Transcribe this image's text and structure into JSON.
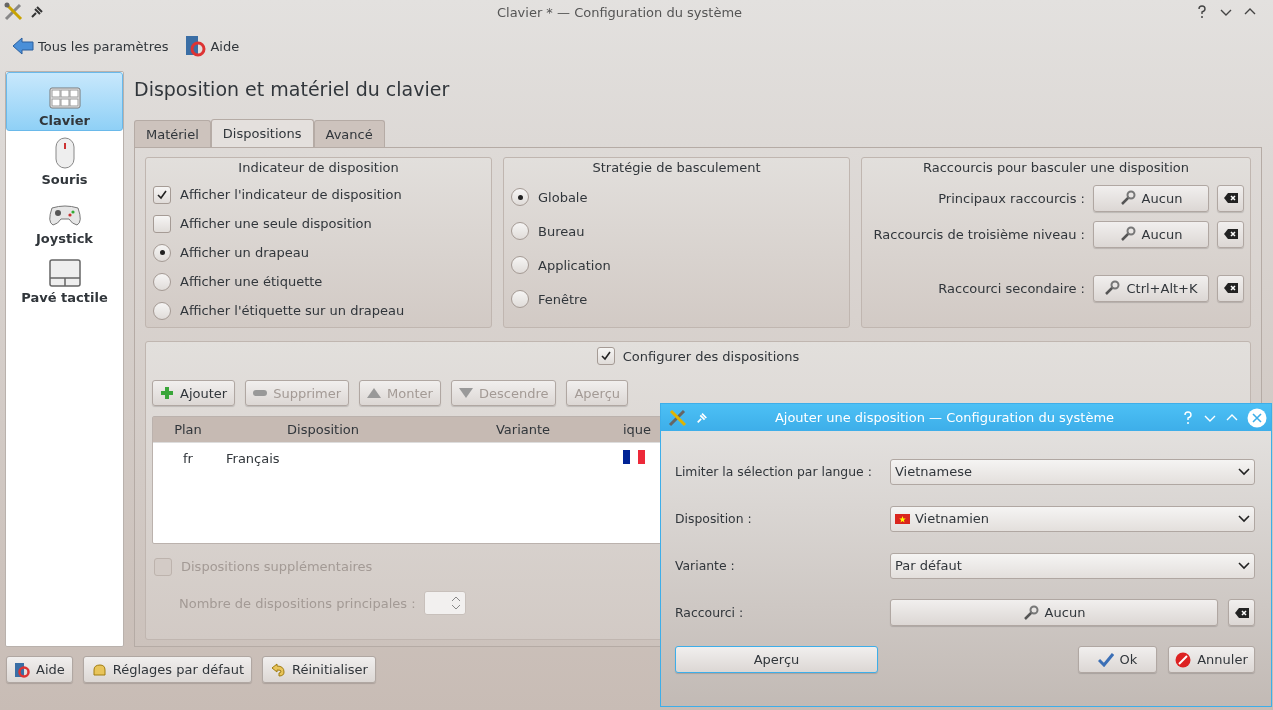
{
  "window": {
    "title": "Clavier * — Configuration du système"
  },
  "toolbar": [
    {
      "label": "Tous les paramètres",
      "kind": "back"
    },
    {
      "label": "Aide",
      "kind": "help"
    }
  ],
  "sidebar": {
    "items": [
      {
        "label": "Clavier",
        "kind": "keyboard",
        "selected": true
      },
      {
        "label": "Souris",
        "kind": "mouse",
        "selected": false
      },
      {
        "label": "Joystick",
        "kind": "gamepad",
        "selected": false
      },
      {
        "label": "Pavé tactile",
        "kind": "touchpad",
        "selected": false
      }
    ]
  },
  "page_title": "Disposition et matériel du clavier",
  "tabs": [
    {
      "label": "Matériel",
      "selected": false
    },
    {
      "label": "Dispositions",
      "selected": true
    },
    {
      "label": "Avancé",
      "selected": false
    }
  ],
  "indicator_group": {
    "title": "Indicateur de disposition",
    "options": [
      {
        "label": "Afficher l'indicateur de disposition",
        "kind": "checkbox",
        "checked": true
      },
      {
        "label": "Afficher une seule disposition",
        "kind": "checkbox",
        "checked": false
      },
      {
        "label": "Afficher un drapeau",
        "kind": "radio",
        "selected": true
      },
      {
        "label": "Afficher une étiquette",
        "kind": "radio",
        "selected": false
      },
      {
        "label": "Afficher l'étiquette sur un drapeau",
        "kind": "radio",
        "selected": false
      }
    ]
  },
  "switching_group": {
    "title": "Stratégie de basculement",
    "options": [
      {
        "label": "Globale",
        "selected": true
      },
      {
        "label": "Bureau",
        "selected": false
      },
      {
        "label": "Application",
        "selected": false
      },
      {
        "label": "Fenêtre",
        "selected": false
      }
    ]
  },
  "shortcut_group": {
    "title": "Raccourcis pour basculer une disposition",
    "rows": [
      {
        "label": "Principaux raccourcis :",
        "value": "Aucun"
      },
      {
        "label": "Raccourcis de troisième niveau :",
        "value": "Aucun"
      },
      {
        "label": "Raccourci secondaire :",
        "value": "Ctrl+Alt+K"
      }
    ]
  },
  "layouts_group": {
    "title": "Configurer des dispositions",
    "checked": true,
    "buttons": [
      {
        "label": "Ajouter",
        "kind": "add",
        "disabled": false
      },
      {
        "label": "Supprimer",
        "kind": "remove",
        "disabled": true
      },
      {
        "label": "Monter",
        "kind": "up",
        "disabled": true
      },
      {
        "label": "Descendre",
        "kind": "down",
        "disabled": true
      },
      {
        "label": "Aperçu",
        "kind": "plain",
        "disabled": true
      }
    ],
    "table": {
      "columns": [
        "Plan",
        "Disposition",
        "Variante",
        "ique"
      ],
      "rows": [
        {
          "cells": [
            "fr",
            "Français",
            ""
          ]
        }
      ]
    },
    "extra": {
      "label": "Dispositions supplémentaires",
      "checked": false,
      "disabled": true
    },
    "count": {
      "label": "Nombre de dispositions principales :",
      "disabled": true
    }
  },
  "footer_buttons": [
    {
      "label": "Aide",
      "kind": "help"
    },
    {
      "label": "Réglages par défaut",
      "kind": "defaults"
    },
    {
      "label": "Réinitialiser",
      "kind": "reset"
    }
  ],
  "dialog": {
    "title": "Ajouter une disposition — Configuration du système",
    "fields": [
      {
        "label": "Limiter la sélection par langue :",
        "value": "Vietnamese",
        "kind": "select"
      },
      {
        "label": "Disposition :",
        "value": "Vietnamien",
        "kind": "layout-select"
      },
      {
        "label": "Variante :",
        "value": "Par défaut",
        "kind": "select"
      },
      {
        "label": "Raccourci :",
        "value": "Aucun",
        "kind": "shortcut"
      }
    ],
    "preview": {
      "label": "Aperçu",
      "focused": true
    },
    "buttons": [
      {
        "label": "Ok",
        "kind": "ok"
      },
      {
        "label": "Annuler",
        "kind": "cancel"
      }
    ]
  }
}
